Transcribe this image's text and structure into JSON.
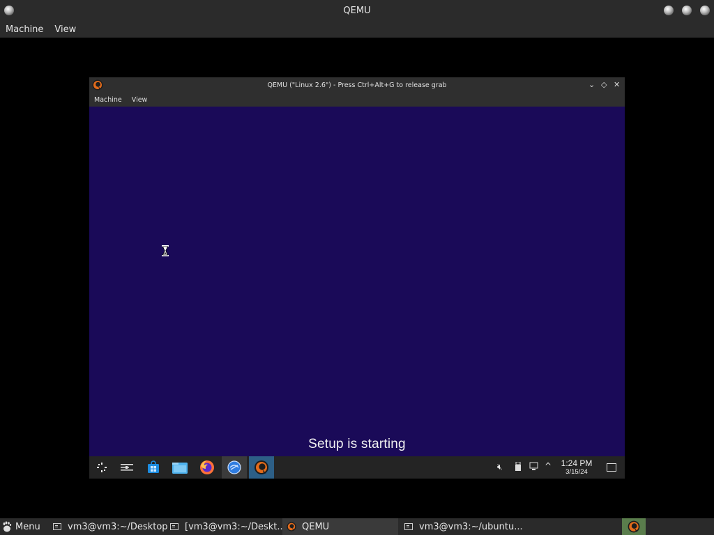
{
  "host": {
    "window_title": "QEMU",
    "menu": [
      "Machine",
      "View"
    ],
    "titlebar_icons": [
      "window-menu-ball-icon",
      "minimize-ball-icon",
      "maximize-ball-icon",
      "close-ball-icon"
    ]
  },
  "guest_window": {
    "title": "QEMU (\"Linux 2.6\") - Press Ctrl+Alt+G to release grab",
    "menu": [
      "Machine",
      "View"
    ],
    "controls": {
      "minimize": "⌄",
      "maximize": "◇",
      "close": "✕"
    }
  },
  "vm_screen": {
    "background": "#1a0a58",
    "status_text": "Setup is starting",
    "cursor": "hourglass-icon"
  },
  "guest_taskbar": {
    "apps": [
      "start-icon",
      "task-view-icon",
      "store-icon",
      "file-explorer-icon",
      "firefox-icon",
      "browser-icon",
      "qemu-icon"
    ],
    "tray_icons": [
      "volume-muted-icon",
      "usb-icon",
      "network-icon",
      "show-hidden-icons-chevron"
    ],
    "time": "1:24 PM",
    "date": "3/15/24"
  },
  "host_panel": {
    "menu_label": "Menu",
    "tasks": [
      {
        "label": "vm3@vm3:~/Desktop"
      },
      {
        "label": "[vm3@vm3:~/Deskt..."
      },
      {
        "label": "QEMU"
      },
      {
        "label": "vm3@vm3:~/ubuntu..."
      }
    ]
  }
}
